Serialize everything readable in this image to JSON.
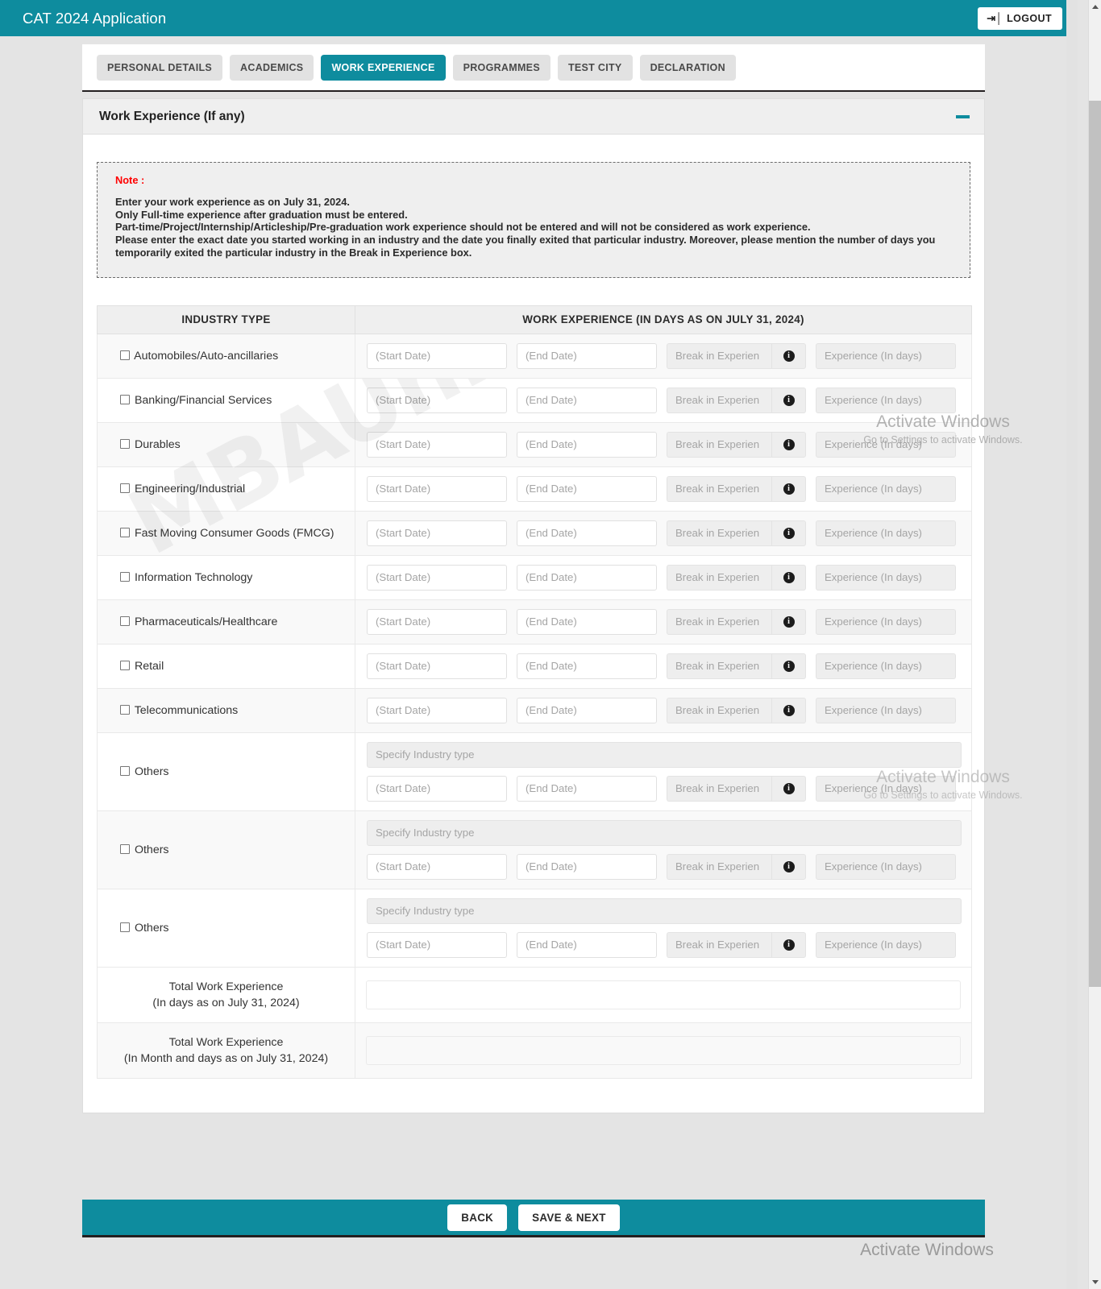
{
  "header": {
    "app_title": "CAT 2024 Application",
    "logout_label": "LOGOUT",
    "logout_icon": "logout-icon",
    "brand_color": "#0e8c9e"
  },
  "tabs": [
    {
      "label": "PERSONAL DETAILS",
      "active": false
    },
    {
      "label": "ACADEMICS",
      "active": false
    },
    {
      "label": "WORK EXPERIENCE",
      "active": true
    },
    {
      "label": "PROGRAMMES",
      "active": false
    },
    {
      "label": "TEST CITY",
      "active": false
    },
    {
      "label": "DECLARATION",
      "active": false
    }
  ],
  "panel": {
    "title": "Work Experience (If any)",
    "collapse_icon": "minus-icon"
  },
  "note": {
    "label": "Note :",
    "lines": [
      "Enter your work experience as on July 31, 2024.",
      "Only Full-time experience after graduation must be entered.",
      "Part-time/Project/Internship/Articleship/Pre-graduation work experience should not be entered and will not be considered as work experience.",
      "Please enter the exact date you started working in an industry and the date you finally exited that particular industry. Moreover, please mention the number of days you temporarily exited the particular industry in the Break in Experience box."
    ],
    "note_color": "#ff0000"
  },
  "table": {
    "headers": {
      "industry": "INDUSTRY TYPE",
      "experience": "WORK EXPERIENCE (IN DAYS AS ON JULY 31, 2024)"
    },
    "placeholders": {
      "start_date": "(Start Date)",
      "end_date": "(End Date)",
      "break": "Break in Experien",
      "experience": "Experience (In days)",
      "specify": "Specify Industry type"
    },
    "info_icon": "info-circle-icon",
    "rows": [
      {
        "label": "Automobiles/Auto-ancillaries",
        "checked": false,
        "has_specify": false
      },
      {
        "label": "Banking/Financial Services",
        "checked": false,
        "has_specify": false
      },
      {
        "label": "Durables",
        "checked": false,
        "has_specify": false
      },
      {
        "label": "Engineering/Industrial",
        "checked": false,
        "has_specify": false
      },
      {
        "label": "Fast Moving Consumer Goods (FMCG)",
        "checked": false,
        "has_specify": false
      },
      {
        "label": "Information Technology",
        "checked": false,
        "has_specify": false
      },
      {
        "label": "Pharmaceuticals/Healthcare",
        "checked": false,
        "has_specify": false
      },
      {
        "label": "Retail",
        "checked": false,
        "has_specify": false
      },
      {
        "label": "Telecommunications",
        "checked": false,
        "has_specify": false
      },
      {
        "label": "Others",
        "checked": false,
        "has_specify": true
      },
      {
        "label": "Others",
        "checked": false,
        "has_specify": true
      },
      {
        "label": "Others",
        "checked": false,
        "has_specify": true
      }
    ],
    "totals": [
      {
        "line1": "Total Work Experience",
        "line2": "(In days as on July 31, 2024)",
        "value": ""
      },
      {
        "line1": "Total Work Experience",
        "line2": "(In Month and days as on July 31, 2024)",
        "value": ""
      }
    ]
  },
  "footer": {
    "back_label": "BACK",
    "save_next_label": "SAVE & NEXT"
  },
  "watermarks": {
    "site": "MBAUniverse.com",
    "windows_title": "Activate Windows",
    "windows_sub": "Go to Settings to activate Windows."
  }
}
